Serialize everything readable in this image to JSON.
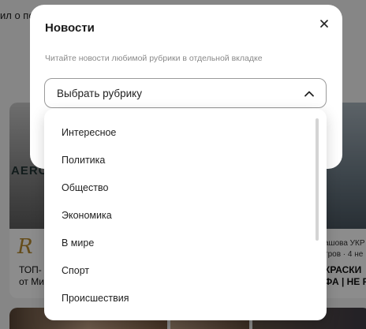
{
  "background": {
    "snippet": "ил о по",
    "left_card": {
      "photo_text": "AERO",
      "logo": "R",
      "text": "ТОП-\nот Ми"
    },
    "right_card": {
      "source": "ашова УКР\nтров · 4 не",
      "text": "КРАСКИ\nФА | НЕ Р"
    }
  },
  "modal": {
    "title": "Новости",
    "description": "Читайте новости любимой рубрики в отдельной вкладке",
    "close_icon": "close-icon",
    "select": {
      "value": "Выбрать рубрику",
      "icon": "chevron-up-icon",
      "expanded": true
    }
  },
  "dropdown": {
    "items": [
      {
        "label": "Интересное"
      },
      {
        "label": "Политика"
      },
      {
        "label": "Общество"
      },
      {
        "label": "Экономика"
      },
      {
        "label": "В мире"
      },
      {
        "label": "Спорт"
      },
      {
        "label": "Происшествия"
      }
    ]
  },
  "colors": {
    "overlay": "#000000",
    "modal_bg": "#ffffff",
    "accent_red": "#e84c3d"
  }
}
